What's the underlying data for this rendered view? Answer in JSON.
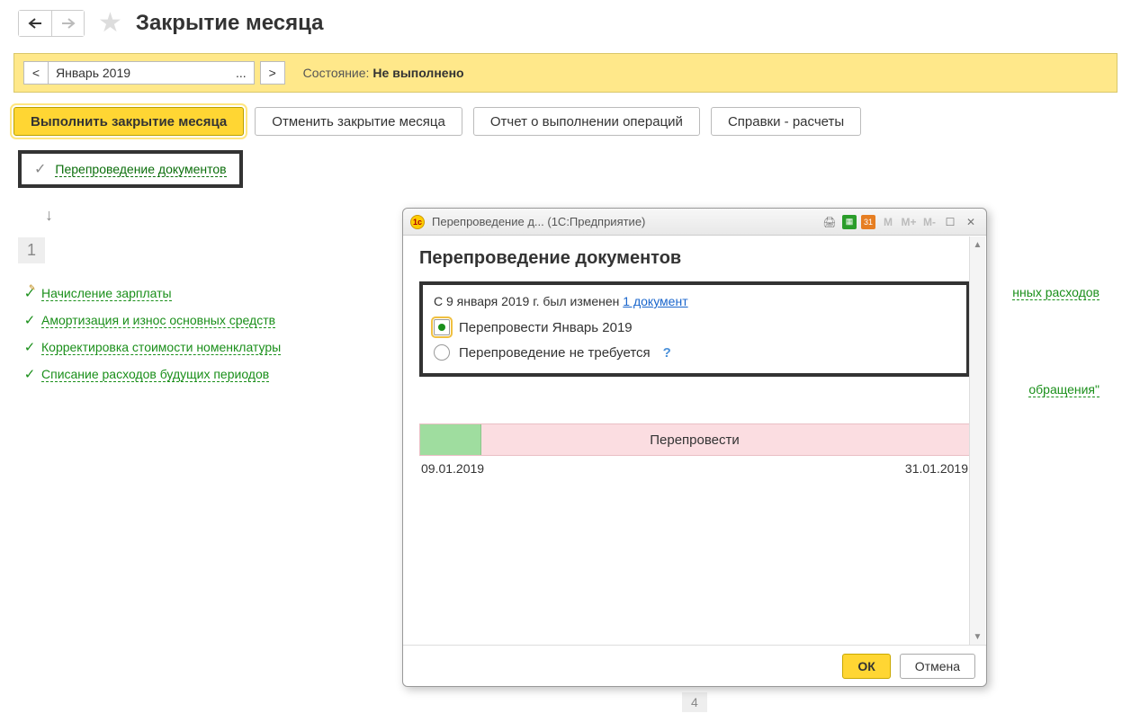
{
  "header": {
    "title": "Закрытие месяца"
  },
  "period": {
    "value": "Январь 2019",
    "state_label": "Состояние:",
    "state_value": "Не выполнено"
  },
  "actions": {
    "run": "Выполнить закрытие месяца",
    "cancel": "Отменить закрытие месяца",
    "report": "Отчет о выполнении операций",
    "refs": "Справки - расчеты"
  },
  "reprov_link": "Перепроведение документов",
  "section_number": "1",
  "ops": [
    "Начисление зарплаты",
    "Амортизация и износ основных средств",
    "Корректировка стоимости номенклатуры",
    "Списание расходов будущих периодов"
  ],
  "partial": {
    "a": "нных расходов",
    "b": "обращения\""
  },
  "bottom_section": "4",
  "dialog": {
    "title": "Перепроведение д... (1С:Предприятие)",
    "heading": "Перепроведение документов",
    "info_prefix": "С 9 января 2019 г. был изменен ",
    "info_link": "1 документ",
    "radio1": "Перепровести Январь 2019",
    "radio2": "Перепроведение не требуется",
    "bar_label": "Перепровести",
    "date_from": "09.01.2019",
    "date_to": "31.01.2019",
    "ok": "ОК",
    "cancel": "Отмена"
  }
}
